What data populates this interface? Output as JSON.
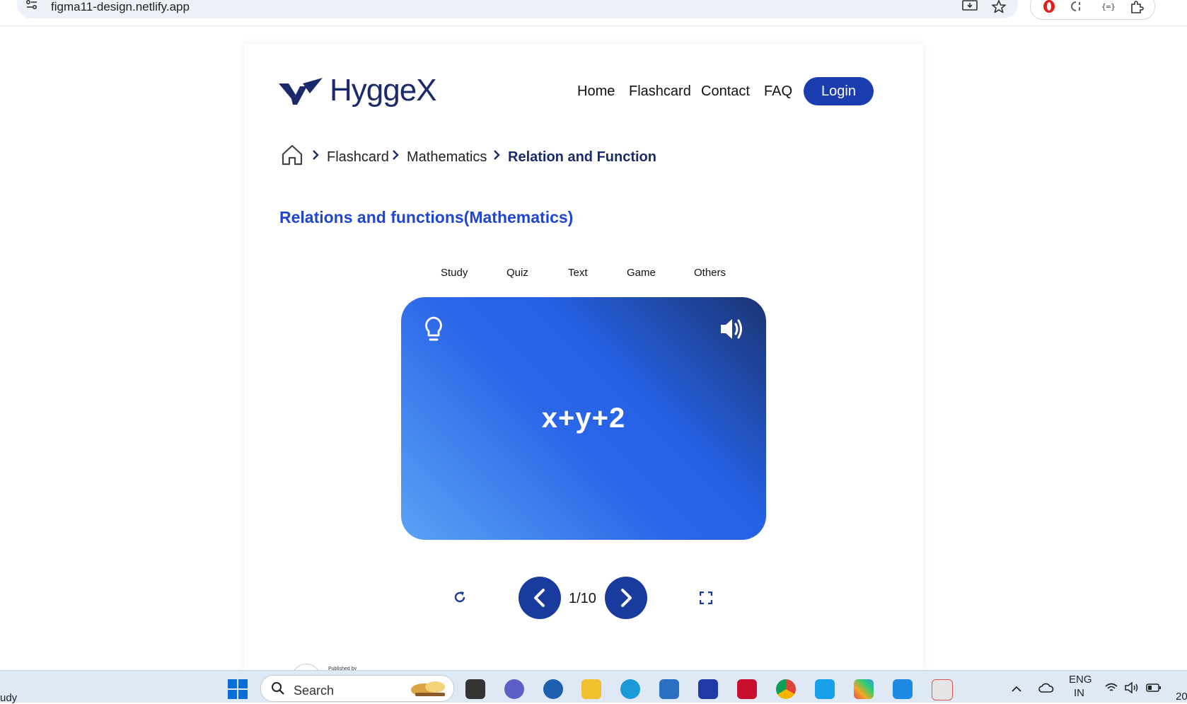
{
  "browser": {
    "url": "figma11-design.netlify.app"
  },
  "brand": {
    "logo_text": "HyggeX",
    "primary_color": "#1a3eb0",
    "title_color": "#1f45d6"
  },
  "nav": {
    "items": [
      "Home",
      "Flashcard",
      "Contact",
      "FAQ"
    ],
    "login_label": "Login"
  },
  "breadcrumb": {
    "items": [
      "Flashcard",
      "Mathematics",
      "Relation and Function"
    ]
  },
  "page": {
    "title": "Relations and functions(Mathematics)"
  },
  "tabs": [
    "Study",
    "Quiz",
    "Text",
    "Game",
    "Others"
  ],
  "flashcard": {
    "content": "x+y+2",
    "counter": "1/10"
  },
  "footer": {
    "published_by": "Published by"
  },
  "taskbar": {
    "left_text": "udy",
    "search_placeholder": "Search",
    "language_line1": "ENG",
    "language_line2": "IN",
    "clock_partial": "20"
  }
}
